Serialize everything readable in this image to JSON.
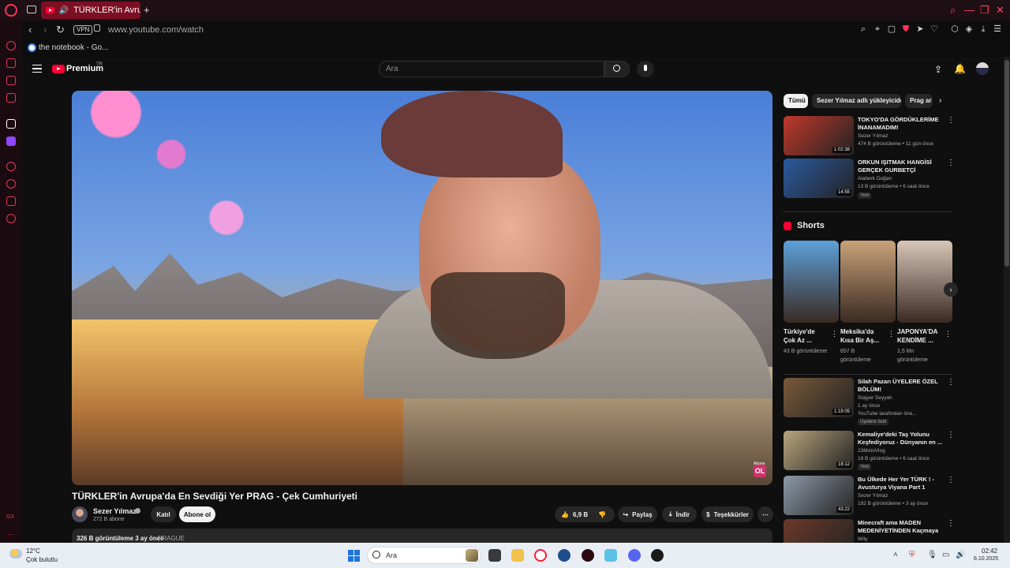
{
  "browser": {
    "tab_title": "TÜRKLER'in Avrupa'da",
    "new_tab": "+",
    "nav_back": "‹",
    "nav_forward": "›",
    "reload": "↻",
    "vpn": "VPN",
    "url": "www.youtube.com/watch",
    "bookmark": "the notebook - Go...",
    "win_search": "⌕",
    "win_minimize": "—",
    "win_maximize": "❐",
    "win_close": "✕"
  },
  "youtube": {
    "brand": "Premium",
    "region": "TR",
    "search_placeholder": "Ara",
    "video_title": "TÜRKLER'in Avrupa'da En Sevdiği Yer PRAG - Çek Cumhuriyeti",
    "channel": "Sezer Yılmaz",
    "subscribers": "272 B abone",
    "join": "Katıl",
    "subscribe": "Abone ol",
    "likes": "6,9 B",
    "share": "Paylaş",
    "download": "İndir",
    "thanks": "Teşekkürler",
    "more": "⋯",
    "views_date": "326 B görüntüleme  3 ay önce",
    "tag": "PRAGUE",
    "ol_small": "Abone",
    "ol": "OL"
  },
  "chips": [
    "Tümü",
    "Sezer Yılmaz adlı yükleyiciden",
    "Prag ar"
  ],
  "recommendations": [
    {
      "title": "TOKYO'DA GÖRDÜKLERİME İNANAMADIM!",
      "channel": "Sezer Yılmaz",
      "meta": "474 B görüntüleme • 11 gün önce",
      "duration": "1:02:38",
      "badge": "",
      "color": "#c0392b"
    },
    {
      "title": "ORKUN IŞITMAK HANGİSİ GERÇEK GURBETÇİ İZLİYORUZ!",
      "channel": "Alaberk Doğan",
      "meta": "13 B görüntüleme • 6 saat önce",
      "duration": "14:55",
      "badge": "Yeni",
      "color": "#2c5aa0"
    }
  ],
  "shorts": {
    "label": "Shorts",
    "items": [
      {
        "title": "Türkiye'de Çok Az ...",
        "views": "43 B görüntüleme",
        "color": "#5da0d8"
      },
      {
        "title": "Meksika'da Kısa Bir Aş...",
        "views": "657 B görüntüleme",
        "color": "#c9a27a"
      },
      {
        "title": "JAPONYA'DA KENDİME ...",
        "views": "1,5 Mn görüntüleme",
        "color": "#d8c6b8"
      }
    ]
  },
  "recommendations2": [
    {
      "title": "Silah Pazarı ÜYELERE ÖZEL BÖLÜM!",
      "channel": "Stajyer Seyyah",
      "meta": "1 ay önce",
      "extra": "YouTube tarafından öne...",
      "badge": "Üyelere özel",
      "duration": "1:19:05",
      "color": "#7a5a3a"
    },
    {
      "title": "Kemaliye'deki Taş Yolunu Keşfediyoruz - Dünyanın en ...",
      "channel": "23MotoVlog",
      "meta": "19 B görüntüleme • 6 saat önce",
      "extra": "",
      "badge": "Yeni",
      "duration": "18:12",
      "color": "#b9a57e"
    },
    {
      "title": "Bu Ülkede Her Yer TÜRK ! - Avusturya Viyana Part 1",
      "channel": "Sezer Yılmaz",
      "meta": "192 B görüntüleme • 3 ay önce",
      "extra": "",
      "badge": "",
      "duration": "43:22",
      "color": "#8e9aa8"
    },
    {
      "title": "Minecraft ama MADEN MEDENİYETİNDEN Kaçmaya ...",
      "channel": "Wity",
      "meta": "",
      "extra": "",
      "badge": "",
      "duration": "",
      "color": "#6b3a2a"
    }
  ],
  "taskbar": {
    "temp": "12°C",
    "weather": "Çok bulutlu",
    "search": "Ara",
    "time": "02:42",
    "date": "6.10.2025"
  }
}
